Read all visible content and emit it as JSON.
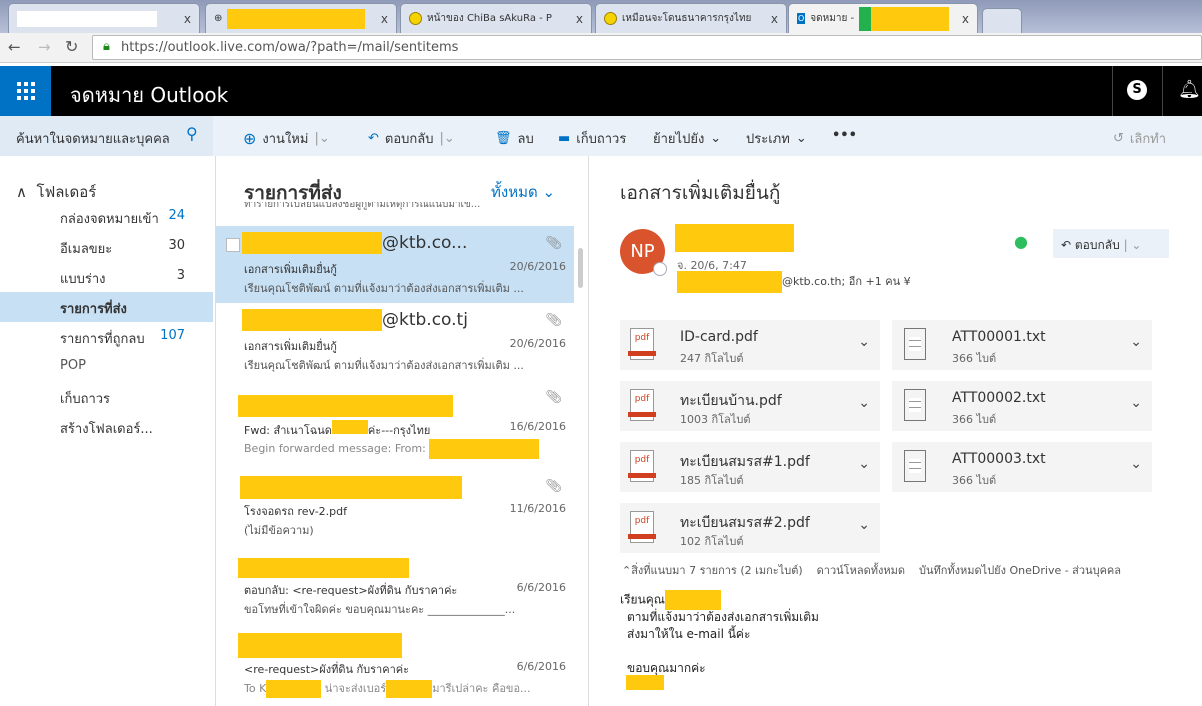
{
  "browser": {
    "tabs": [
      {
        "label": ""
      },
      {
        "label": ""
      },
      {
        "label": "หน้าของ ChiBa sAkuRa - P"
      },
      {
        "label": "เหมือนจะโดนธนาคารกรุงไทย"
      },
      {
        "label": "จดหมาย -"
      }
    ],
    "url": "https://outlook.live.com/owa/?path=/mail/sentitems"
  },
  "header": {
    "title": "จดหมาย Outlook"
  },
  "search": {
    "placeholder": "ค้นหาในจดหมายและบุคคล"
  },
  "toolbar": {
    "new": "งานใหม่",
    "reply": "ตอบกลับ",
    "delete": "ลบ",
    "archive": "เก็บถาวร",
    "move": "ย้ายไปยัง",
    "category": "ประเภท",
    "more": "•••",
    "undo": "เลิกทำ"
  },
  "folders": {
    "heading": "โฟลเดอร์",
    "items": [
      {
        "label": "กล่องจดหมายเข้า",
        "count": "24"
      },
      {
        "label": "อีเมลขยะ",
        "count": "30"
      },
      {
        "label": "แบบร่าง",
        "count": "3"
      },
      {
        "label": "รายการที่ส่ง",
        "count": ""
      },
      {
        "label": "รายการที่ถูกลบ",
        "count": "107"
      },
      {
        "label": "POP",
        "count": ""
      },
      {
        "label": "เก็บถาวร",
        "count": ""
      },
      {
        "label": "สร้างโฟลเดอร์...",
        "count": ""
      }
    ]
  },
  "list": {
    "title": "รายการที่ส่ง",
    "filter": "ทั้งหมด",
    "cut_preview": "ทำรายการเปลี่ยนแปลงชื่อผู้กู้ตามเหตุการณ์แนบมาเข้...",
    "items": [
      {
        "from": "@ktb.co...",
        "subject": "เอกสารเพิ่มเติมยื่นกู้",
        "date": "20/6/2016",
        "preview": "เรียนคุณโชติพัฒน์ ตามที่แจ้งมาว่าต้องส่งเอกสารเพิ่มเติม ..."
      },
      {
        "from": "@ktb.co.tj",
        "subject": "เอกสารเพิ่มเติมยื่นกู้",
        "date": "20/6/2016",
        "preview": "เรียนคุณโชติพัฒน์ ตามที่แจ้งมาว่าต้องส่งเอกสารเพิ่มเติม ..."
      },
      {
        "from": "",
        "subject": "Fwd: สำเนาโฉนด",
        "subject2": "ค่ะ---กรุงไทย",
        "date": "16/6/2016",
        "preview": "Begin forwarded message:  From:"
      },
      {
        "from": "",
        "subject": "โรงจอดรถ rev-2.pdf",
        "date": "11/6/2016",
        "preview": "(ไม่มีข้อความ)"
      },
      {
        "from": "",
        "subject": "ตอบกลับ: <re-request>ผังที่ดิน กับราคาค่ะ",
        "date": "6/6/2016",
        "preview": "ขอโทษที่เข้าใจผิดค่ะ ขอบคุณมานะคะ  ______________..."
      },
      {
        "from": "",
        "subject": "<re-request>ผังที่ดิน กับราคาค่ะ",
        "date": "6/6/2016",
        "preview": "To K",
        "preview2": "น่าจะส่งเบอร์",
        "preview3": "มารีเปล่าคะ คือขอ..."
      }
    ]
  },
  "message": {
    "subject": "เอกสารเพิ่มเติมยื่นกู้",
    "avatar": "NP",
    "date": "จ. 20/6, 7:47",
    "to": "@ktb.co.th; อีก +1 คน",
    "reply": "ตอบกลับ",
    "attachments": [
      {
        "name": "ID-card.pdf",
        "size": "247 กิโลไบต์",
        "type": "pdf"
      },
      {
        "name": "ATT00001.txt",
        "size": "366 ไบต์",
        "type": "txt"
      },
      {
        "name": "ทะเบียนบ้าน.pdf",
        "size": "1003 กิโลไบต์",
        "type": "pdf"
      },
      {
        "name": "ATT00002.txt",
        "size": "366 ไบต์",
        "type": "txt"
      },
      {
        "name": "ทะเบียนสมรส#1.pdf",
        "size": "185 กิโลไบต์",
        "type": "pdf"
      },
      {
        "name": "ATT00003.txt",
        "size": "366 ไบต์",
        "type": "txt"
      },
      {
        "name": "ทะเบียนสมรส#2.pdf",
        "size": "102 กิโลไบต์",
        "type": "pdf"
      }
    ],
    "att_summary": "สิ่งที่แนบมา 7 รายการ (2 เมกะไบต์)",
    "download_all": "ดาวน์โหลดทั้งหมด",
    "save_onedrive": "บันทึกทั้งหมดไปยัง OneDrive - ส่วนบุคคล",
    "body": {
      "greeting": "เรียนคุณ",
      "line1": "ตามที่แจ้งมาว่าต้องส่งเอกสารเพิ่มเติม",
      "line2": "ส่งมาให้ใน e-mail นี้ค่ะ",
      "thanks": "ขอบคุณมากค่ะ"
    }
  },
  "colors": {
    "accent": "#0072c6",
    "selected": "#c7e0f4",
    "redaction": "#ffc90e",
    "avatar": "#d9532c"
  }
}
